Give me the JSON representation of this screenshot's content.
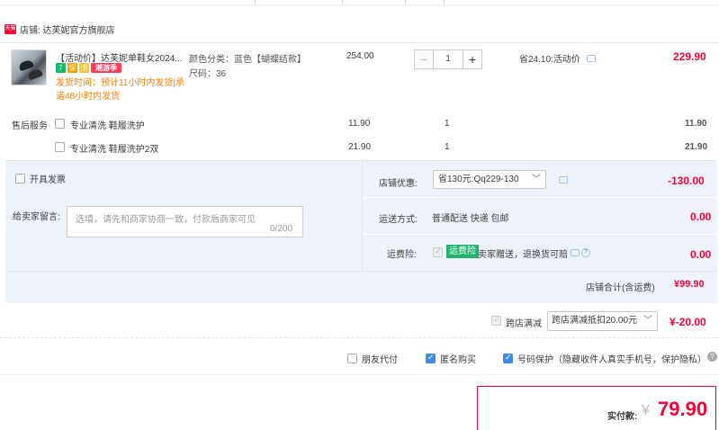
{
  "shop": {
    "name": "店铺: 达芙妮官方旗舰店",
    "logo": "天猫"
  },
  "item": {
    "title": "【活动价】达芙妮单鞋女2024...",
    "badges": [
      "7",
      "保",
      "卡"
    ],
    "promo_tag": "潮游季",
    "shipping_note": "发货时间：预计11小时内发货|承诺48小时内发货",
    "sku_color": "颜色分类：蓝色【蝴蝶结款】",
    "sku_size": "尺码：36",
    "price": "254.00",
    "quantity": "1",
    "minus": "−",
    "plus": "+",
    "saving": "省24.10:活动价",
    "subtotal": "229.90"
  },
  "services": {
    "label": "售后服务",
    "items": [
      {
        "name": "专业清洗 鞋履洗护",
        "price": "11.90",
        "qty": "1",
        "total": "11.90"
      },
      {
        "name": "专业清洗 鞋履洗护2双",
        "price": "21.90",
        "qty": "1",
        "total": "21.90"
      }
    ]
  },
  "order": {
    "invoice_label": "开具发票",
    "message_label": "给卖家留言:",
    "message_placeholder": "选填，请先和商家协商一致，付款后商家可见",
    "message_count": "0/200",
    "shop_discount_label": "店铺优惠:",
    "shop_discount_select": "省130元:Qq229-130",
    "shop_discount_amount": "-130.00",
    "shipping_label": "运送方式:",
    "shipping_value": "普通配送 快递 包邮",
    "shipping_amount": "0.00",
    "insurance_label": "运费险:",
    "insurance_badge": "运费险",
    "insurance_text": "卖家赠送，退换货可赔",
    "insurance_amount": "0.00",
    "shop_total_label": "店铺合计(含运费)",
    "shop_total": "¥99.90"
  },
  "cross_store": {
    "label": "跨店满减",
    "select": "跨店满减抵扣20.00元",
    "amount": "¥-20.00"
  },
  "options": {
    "friend_pay": "朋友代付",
    "anonymous": "匿名购买",
    "number_protect": "号码保护（隐藏收件人真实手机号，保护隐私）"
  },
  "payment": {
    "label": "实付款:",
    "currency": "¥",
    "amount": "79.90"
  },
  "colors": {
    "accent": "#ff0036",
    "panel": "#eef3fb",
    "link": "#3a8ee6",
    "ship_note": "#ff7d00"
  },
  "icons": [
    "chevron-down-icon",
    "chat-icon",
    "question-icon",
    "help-icon",
    "checkbox-icon"
  ]
}
